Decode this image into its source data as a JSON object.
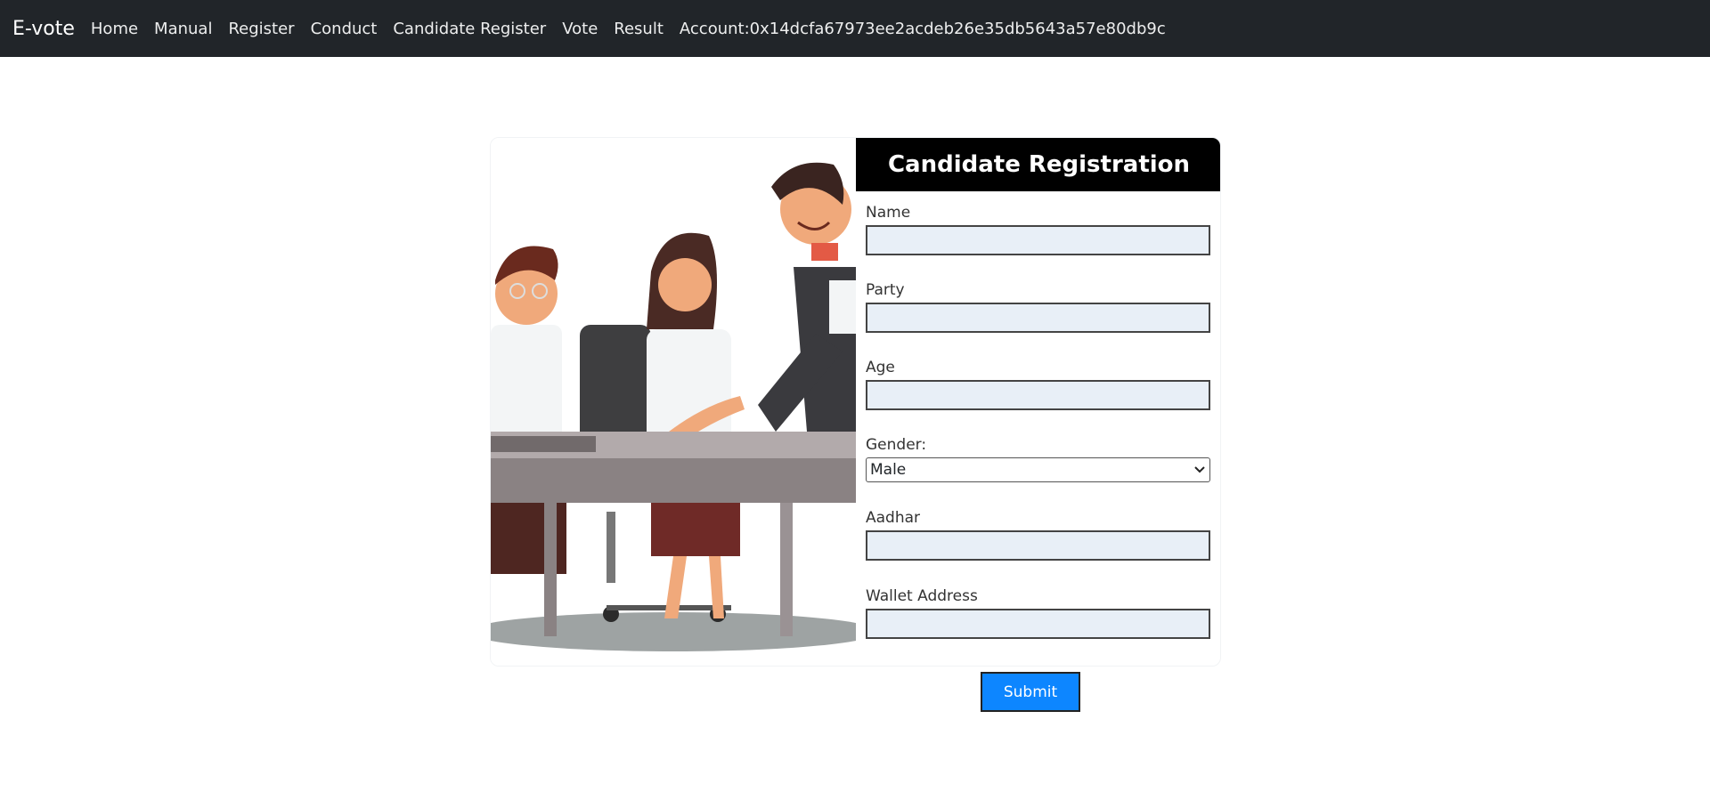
{
  "nav": {
    "brand": "E-vote",
    "links": [
      "Home",
      "Manual",
      "Register",
      "Conduct",
      "Candidate Register",
      "Vote",
      "Result"
    ],
    "account": "Account:0x14dcfa67973ee2acdeb26e35db5643a57e80db9c"
  },
  "form": {
    "title": "Candidate Registration",
    "fields": {
      "name": {
        "label": "Name",
        "value": ""
      },
      "party": {
        "label": "Party",
        "value": ""
      },
      "age": {
        "label": "Age",
        "value": ""
      },
      "gender": {
        "label": "Gender:",
        "value": "Male"
      },
      "aadhar": {
        "label": "Aadhar",
        "value": ""
      },
      "wallet": {
        "label": "Wallet Address",
        "value": ""
      }
    },
    "submit_label": "Submit"
  },
  "colors": {
    "navbar": "#212529",
    "header": "#000000",
    "input_bg": "#e8eff7",
    "submit_bg": "#0d86ff"
  }
}
